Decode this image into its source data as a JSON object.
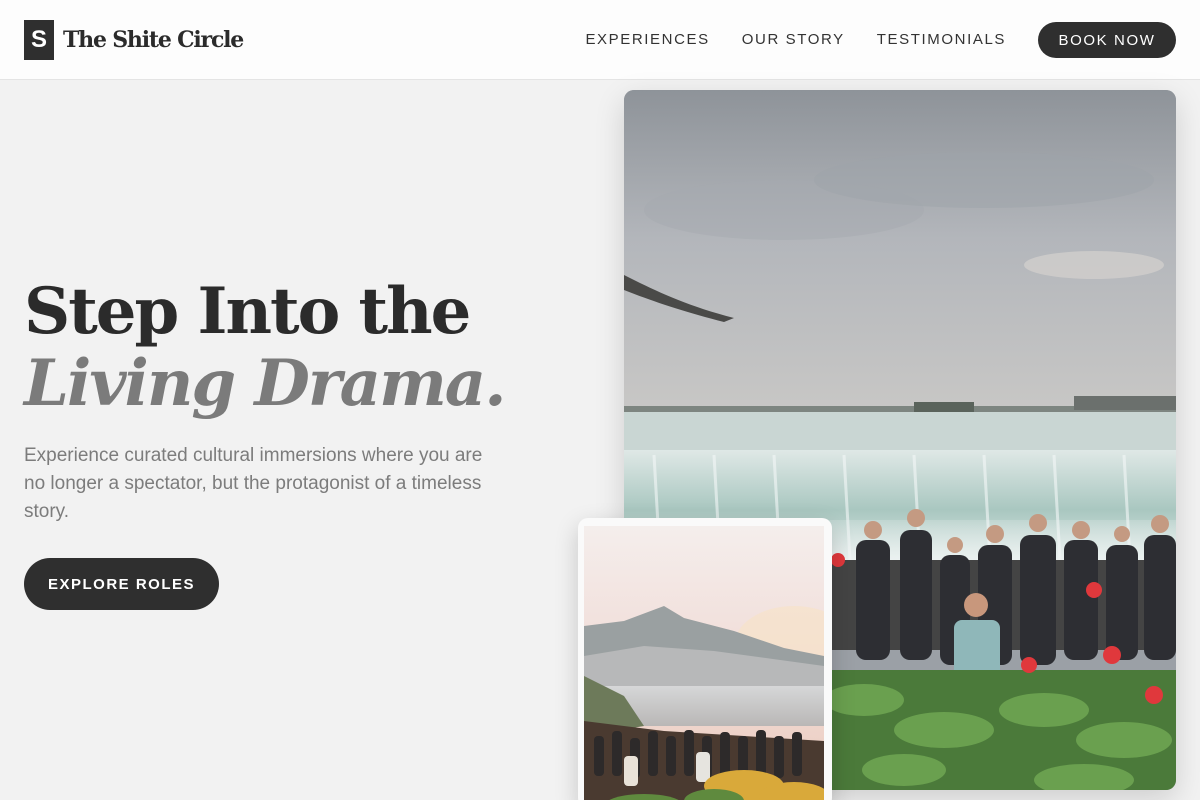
{
  "brand": {
    "mark": "S",
    "name": "The Shite Circle"
  },
  "nav": {
    "items": [
      "EXPERIENCES",
      "OUR STORY",
      "TESTIMONIALS"
    ],
    "cta": "BOOK NOW"
  },
  "hero": {
    "title_line1": "Step Into the",
    "title_line2": "Living Drama.",
    "subtitle": "Experience curated cultural immersions where you are no longer a spectator, but the protagonist of a timeless story.",
    "cta": "EXPLORE ROLES"
  },
  "colors": {
    "background": "#f2f2f2",
    "dark": "#2f2f2f",
    "muted_text": "#7b7b7b"
  }
}
